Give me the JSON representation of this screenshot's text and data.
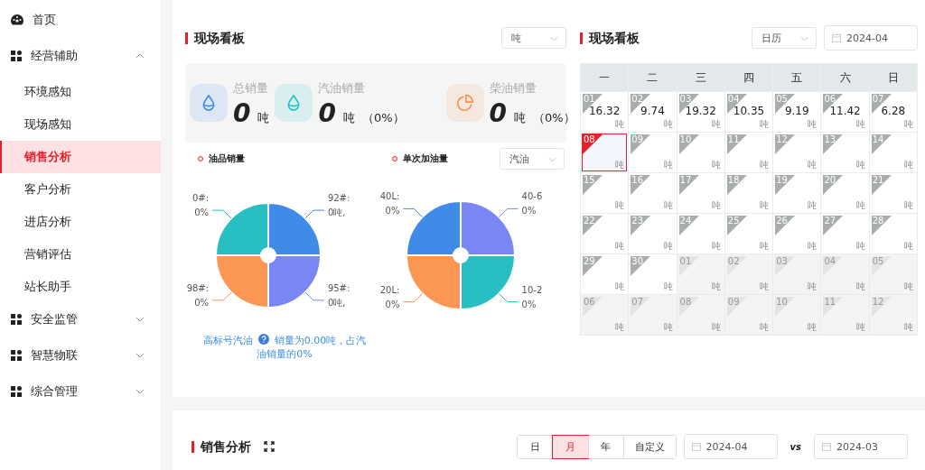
{
  "sidebar": {
    "items": [
      {
        "label": "首页",
        "kind": "dashboard",
        "selected": false
      },
      {
        "label": "经营辅助",
        "kind": "group",
        "expanded": true,
        "children": [
          {
            "label": "环境感知",
            "selected": false
          },
          {
            "label": "现场感知",
            "selected": false
          },
          {
            "label": "销售分析",
            "selected": true
          },
          {
            "label": "客户分析",
            "selected": false
          },
          {
            "label": "进店分析",
            "selected": false
          },
          {
            "label": "营销评估",
            "selected": false
          },
          {
            "label": "站长助手",
            "selected": false
          }
        ]
      },
      {
        "label": "安全监管",
        "kind": "group",
        "expanded": false
      },
      {
        "label": "智慧物联",
        "kind": "group",
        "expanded": false
      },
      {
        "label": "综合管理",
        "kind": "group",
        "expanded": false
      }
    ]
  },
  "board": {
    "title": "现场看板",
    "unit_select": "吨",
    "stats": [
      {
        "label": "总销量",
        "kind": "drop",
        "color": "#3f8ce9",
        "value": "0",
        "unit": "吨"
      },
      {
        "label": "汽油销量",
        "kind": "drop",
        "color": "#22c4c0",
        "value": "0",
        "unit": "吨",
        "share": "（0%）"
      },
      {
        "label": "柴油销量",
        "kind": "pie",
        "color": "#f7954e",
        "value": "0",
        "unit": "吨",
        "share": "（0%）"
      }
    ],
    "pies": [
      {
        "title": "油品销量",
        "slices": [
          {
            "name": "0#:",
            "value": "0%",
            "color": "#27bfc2"
          },
          {
            "name": "92#:",
            "value": "0吨,",
            "color": "#418be8"
          },
          {
            "name": "98#:",
            "value": "0%",
            "color": "#fb9654"
          },
          {
            "name": "95#:",
            "value": "0吨,",
            "color": "#7b86f5"
          }
        ]
      },
      {
        "title": "单次加油量",
        "select": "汽油",
        "slices": [
          {
            "name": "40L:",
            "value": "0%",
            "color": "#418be8"
          },
          {
            "name": "40-6",
            "value": "0%",
            "color": "#7b86f5"
          },
          {
            "name": "20L:",
            "value": "0%",
            "color": "#fb9654"
          },
          {
            "name": "10-2",
            "value": "0%",
            "color": "#27bfc2"
          }
        ]
      }
    ],
    "note_link": "高标号汽油",
    "note_text": "销量为0.00吨，占汽油销量的0%"
  },
  "calendar": {
    "title": "现场看板",
    "mode_select": "日历",
    "month": "2024-04",
    "weekdays": [
      "一",
      "二",
      "三",
      "四",
      "五",
      "六",
      "日"
    ],
    "days": [
      {
        "day": "01",
        "value": "16.32",
        "unit": "吨",
        "current": true,
        "selected": false
      },
      {
        "day": "02",
        "value": "9.74",
        "unit": "吨",
        "current": true,
        "selected": false
      },
      {
        "day": "03",
        "value": "19.32",
        "unit": "吨",
        "current": true,
        "selected": false
      },
      {
        "day": "04",
        "value": "10.35",
        "unit": "吨",
        "current": true,
        "selected": false
      },
      {
        "day": "05",
        "value": "9.19",
        "unit": "吨",
        "current": true,
        "selected": false
      },
      {
        "day": "06",
        "value": "11.42",
        "unit": "吨",
        "current": true,
        "selected": false
      },
      {
        "day": "07",
        "value": "6.28",
        "unit": "吨",
        "current": true,
        "selected": false
      },
      {
        "day": "08",
        "unit": "吨",
        "current": true,
        "selected": true
      },
      {
        "day": "09",
        "unit": "吨",
        "current": true,
        "selected": false
      },
      {
        "day": "10",
        "unit": "吨",
        "current": true,
        "selected": false
      },
      {
        "day": "11",
        "unit": "吨",
        "current": true,
        "selected": false
      },
      {
        "day": "12",
        "unit": "吨",
        "current": true,
        "selected": false
      },
      {
        "day": "13",
        "unit": "吨",
        "current": true,
        "selected": false
      },
      {
        "day": "14",
        "unit": "吨",
        "current": true,
        "selected": false
      },
      {
        "day": "15",
        "unit": "吨",
        "current": true,
        "selected": false
      },
      {
        "day": "16",
        "unit": "吨",
        "current": true,
        "selected": false
      },
      {
        "day": "17",
        "unit": "吨",
        "current": true,
        "selected": false
      },
      {
        "day": "18",
        "unit": "吨",
        "current": true,
        "selected": false
      },
      {
        "day": "19",
        "unit": "吨",
        "current": true,
        "selected": false
      },
      {
        "day": "20",
        "unit": "吨",
        "current": true,
        "selected": false
      },
      {
        "day": "21",
        "unit": "吨",
        "current": true,
        "selected": false
      },
      {
        "day": "22",
        "unit": "吨",
        "current": true,
        "selected": false
      },
      {
        "day": "23",
        "unit": "吨",
        "current": true,
        "selected": false
      },
      {
        "day": "24",
        "unit": "吨",
        "current": true,
        "selected": false
      },
      {
        "day": "25",
        "unit": "吨",
        "current": true,
        "selected": false
      },
      {
        "day": "26",
        "unit": "吨",
        "current": true,
        "selected": false
      },
      {
        "day": "27",
        "unit": "吨",
        "current": true,
        "selected": false
      },
      {
        "day": "28",
        "unit": "吨",
        "current": true,
        "selected": false
      },
      {
        "day": "29",
        "unit": "吨",
        "current": true,
        "selected": false
      },
      {
        "day": "30",
        "unit": "吨",
        "current": true,
        "selected": false
      },
      {
        "day": "01",
        "unit": "吨",
        "current": false,
        "selected": false
      },
      {
        "day": "02",
        "unit": "吨",
        "current": false,
        "selected": false
      },
      {
        "day": "03",
        "unit": "吨",
        "current": false,
        "selected": false
      },
      {
        "day": "04",
        "unit": "吨",
        "current": false,
        "selected": false
      },
      {
        "day": "05",
        "unit": "吨",
        "current": false,
        "selected": false
      },
      {
        "day": "06",
        "unit": "吨",
        "current": false,
        "selected": false
      },
      {
        "day": "07",
        "unit": "吨",
        "current": false,
        "selected": false
      },
      {
        "day": "08",
        "unit": "吨",
        "current": false,
        "selected": false
      },
      {
        "day": "09",
        "unit": "吨",
        "current": false,
        "selected": false
      },
      {
        "day": "10",
        "unit": "吨",
        "current": false,
        "selected": false
      },
      {
        "day": "11",
        "unit": "吨",
        "current": false,
        "selected": false
      },
      {
        "day": "12",
        "unit": "吨",
        "current": false,
        "selected": false
      }
    ]
  },
  "sales": {
    "title": "销售分析",
    "periods": [
      {
        "label": "日",
        "selected": false
      },
      {
        "label": "月",
        "selected": true
      },
      {
        "label": "年",
        "selected": false
      },
      {
        "label": "自定义",
        "selected": false
      }
    ],
    "date_a": "2024-04",
    "vs": "vs",
    "date_b": "2024-03"
  }
}
